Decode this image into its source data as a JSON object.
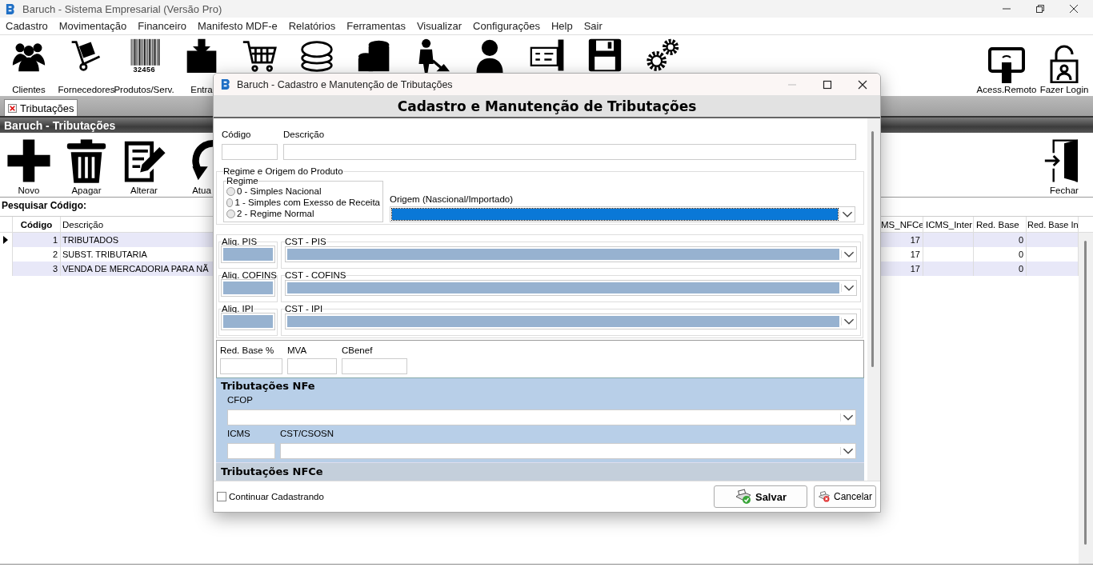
{
  "window": {
    "title": "Baruch - Sistema Empresarial (Versão Pro)"
  },
  "menu": [
    "Cadastro",
    "Movimentação",
    "Financeiro",
    "Manifesto MDF-e",
    "Relatórios",
    "Ferramentas",
    "Visualizar",
    "Configurações",
    "Help",
    "Sair"
  ],
  "toolbar": {
    "left": [
      {
        "kind": "people",
        "label": "Clientes"
      },
      {
        "kind": "handtruck",
        "label": "Fornecedores"
      },
      {
        "kind": "barcode",
        "label": "Produtos/Serv.",
        "caption": "32456"
      },
      {
        "kind": "boxin",
        "label": "Entra"
      },
      {
        "kind": "cart"
      },
      {
        "kind": "coins"
      },
      {
        "kind": "database"
      },
      {
        "kind": "worker"
      },
      {
        "kind": "person"
      },
      {
        "kind": "cheque"
      },
      {
        "kind": "floppy"
      },
      {
        "kind": "gears"
      }
    ],
    "right": [
      {
        "kind": "remote",
        "label": "Acess.Remoto"
      },
      {
        "kind": "login",
        "label": "Fazer Login"
      }
    ]
  },
  "tabs": [
    {
      "label": "Tributações",
      "selected": true
    }
  ],
  "panel": {
    "title": "Baruch - Tributações",
    "actions": [
      {
        "kind": "plus",
        "label": "Novo"
      },
      {
        "kind": "trash",
        "label": "Apagar"
      },
      {
        "kind": "edit",
        "label": "Alterar"
      },
      {
        "kind": "refresh",
        "label": "Atua"
      }
    ],
    "close": {
      "kind": "door",
      "label": "Fechar"
    }
  },
  "search": {
    "label": "Pesquisar Código:"
  },
  "grid": {
    "columns": [
      "Código",
      "Descrição",
      "MS_NFCe",
      "ICMS_Inter",
      "Red. Base",
      "Red. Base In"
    ],
    "rows": [
      {
        "selected": true,
        "cells": [
          "1",
          "TRIBUTADOS",
          "17",
          "",
          "0",
          ""
        ]
      },
      {
        "selected": false,
        "cells": [
          "2",
          "SUBST. TRIBUTARIA",
          "17",
          "",
          "0",
          ""
        ]
      },
      {
        "selected": false,
        "cells": [
          "3",
          "VENDA DE MERCADORIA PARA NÃ",
          "17",
          "",
          "0",
          ""
        ]
      }
    ]
  },
  "dialog": {
    "title": "Baruch - Cadastro e Manutenção de Tributações",
    "heading": "Cadastro e Manutenção de Tributações",
    "codigo": {
      "label": "Código"
    },
    "descricao": {
      "label": "Descrição"
    },
    "regime_group": {
      "title": "Regime e Origem do Produto",
      "regime_title": "Regime",
      "options": [
        {
          "label": "0 - Simples Nacional",
          "selected": false
        },
        {
          "label": "1 - Simples com Exesso de Receita",
          "selected": false
        },
        {
          "label": "2 - Regime Normal",
          "selected": false
        }
      ],
      "origem": {
        "label": "Origem (Nascional/Importado)",
        "focused": true
      }
    },
    "taxes": [
      {
        "rate_label": "Aliq. PIS",
        "cst_label": "CST - PIS",
        "disabled": true
      },
      {
        "rate_label": "Aliq. COFINS",
        "cst_label": "CST - COFINS",
        "disabled": true
      },
      {
        "rate_label": "Aliq. IPI",
        "cst_label": "CST - IPI",
        "disabled": true
      }
    ],
    "small_fields": [
      "Red. Base %",
      "MVA",
      "CBenef"
    ],
    "nfe": {
      "title": "Tributações NFe",
      "cfop_label": "CFOP",
      "icms_label": "ICMS",
      "cst_label": "CST/CSOSN"
    },
    "nfce": {
      "title": "Tributações NFCe"
    },
    "continue": {
      "label": "Continuar Cadastrando",
      "checked": false
    },
    "buttons": [
      {
        "kind": "save",
        "label": "Salvar"
      },
      {
        "kind": "cancel",
        "label": "Cancelar"
      }
    ]
  }
}
